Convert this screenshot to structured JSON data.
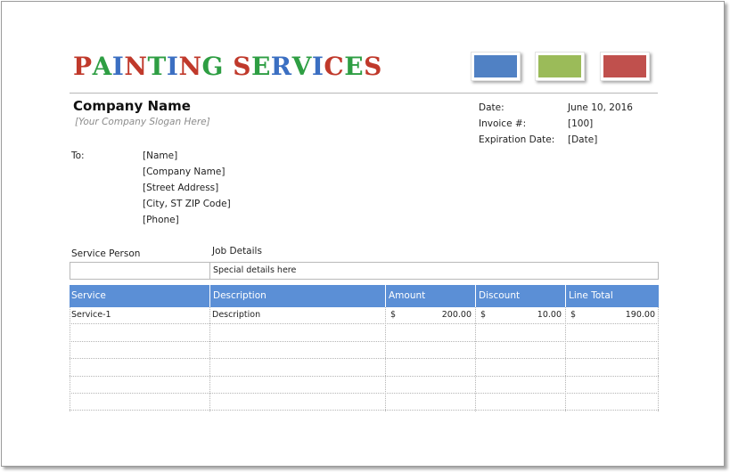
{
  "header": {
    "title_letters": [
      {
        "ch": "P",
        "color": "#c0392b"
      },
      {
        "ch": "A",
        "color": "#2e9e43"
      },
      {
        "ch": "I",
        "color": "#3b6fc2"
      },
      {
        "ch": "N",
        "color": "#c0392b"
      },
      {
        "ch": "T",
        "color": "#2e9e43"
      },
      {
        "ch": "I",
        "color": "#3b6fc2"
      },
      {
        "ch": "N",
        "color": "#c0392b"
      },
      {
        "ch": "G",
        "color": "#2e9e43"
      },
      {
        "ch": " ",
        "color": "#000000"
      },
      {
        "ch": "S",
        "color": "#c0392b"
      },
      {
        "ch": "E",
        "color": "#2e9e43"
      },
      {
        "ch": "R",
        "color": "#3b6fc2"
      },
      {
        "ch": "V",
        "color": "#2e9e43"
      },
      {
        "ch": "I",
        "color": "#3b6fc2"
      },
      {
        "ch": "C",
        "color": "#c0392b"
      },
      {
        "ch": "E",
        "color": "#2e9e43"
      },
      {
        "ch": "S",
        "color": "#c0392b"
      }
    ],
    "swatches": [
      "#5081c4",
      "#9bbb59",
      "#c0504d"
    ]
  },
  "company": {
    "name": "Company Name",
    "slogan": "[Your Company Slogan Here]"
  },
  "meta": {
    "date_label": "Date:",
    "date_value": "June 10, 2016",
    "invoice_label": "Invoice #:",
    "invoice_value": "[100]",
    "expiration_label": "Expiration Date:",
    "expiration_value": "[Date]"
  },
  "bill_to": {
    "label": "To:",
    "lines": [
      "[Name]",
      "[Company Name]",
      "[Street Address]",
      "[City, ST  ZIP Code]",
      "[Phone]"
    ]
  },
  "job": {
    "service_person_label": "Service Person",
    "job_details_label": "Job Details",
    "service_person_value": "",
    "details_value": "Special details here"
  },
  "table": {
    "headers": [
      "Service",
      "Description",
      "Amount",
      "Discount",
      "Line Total"
    ],
    "currency": "$",
    "rows": [
      {
        "service": "Service-1",
        "description": "Description",
        "amount": "200.00",
        "discount": "10.00",
        "line_total": "190.00"
      }
    ],
    "empty_rows": 5
  }
}
